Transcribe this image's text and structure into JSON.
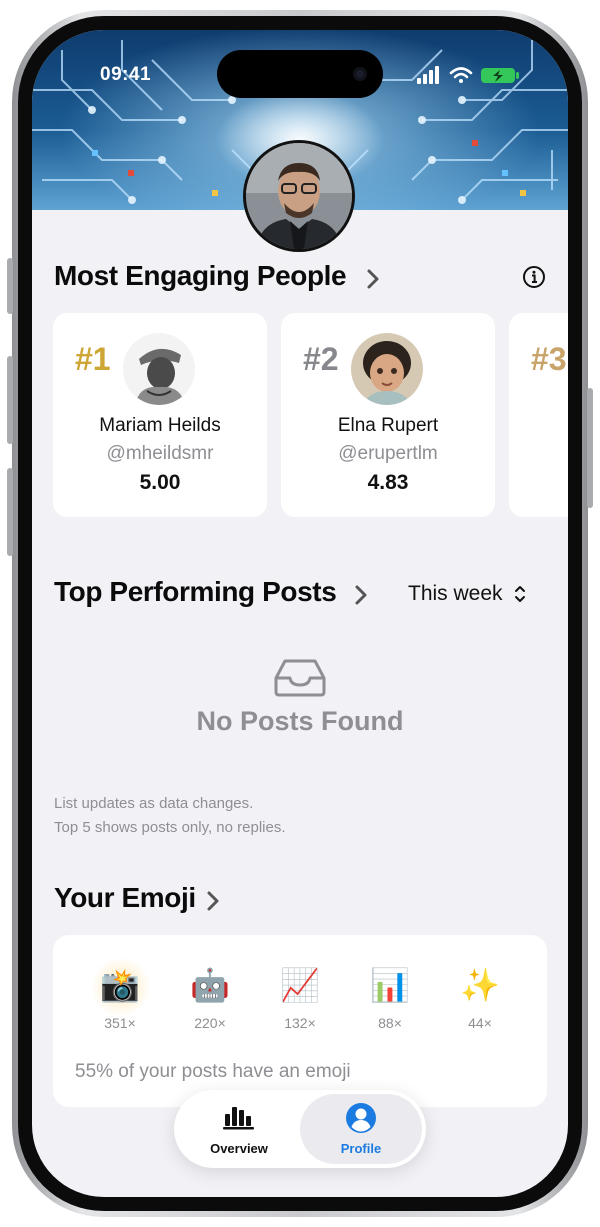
{
  "status_bar": {
    "time": "09:41"
  },
  "engaging": {
    "title": "Most Engaging People",
    "people": [
      {
        "rank": "#1",
        "name": "Mariam Heilds",
        "handle": "@mheildsmr",
        "score": "5.00"
      },
      {
        "rank": "#2",
        "name": "Elna Rupert",
        "handle": "@erupertlm",
        "score": "4.83"
      },
      {
        "rank": "#3",
        "name": "",
        "handle": "",
        "score": ""
      }
    ]
  },
  "posts": {
    "title": "Top Performing Posts",
    "filter": "This week",
    "empty_title": "No Posts Found",
    "footnote_1": "List updates as data changes.",
    "footnote_2": "Top 5 shows posts only, no replies."
  },
  "emoji": {
    "title": "Your Emoji",
    "items": [
      {
        "icon": "camera-with-flash-emoji",
        "glyph": "📸",
        "count": "351×"
      },
      {
        "icon": "robot-emoji",
        "glyph": "🤖",
        "count": "220×"
      },
      {
        "icon": "chart-increasing-emoji",
        "glyph": "📈",
        "count": "132×"
      },
      {
        "icon": "bar-chart-emoji",
        "glyph": "📊",
        "count": "88×"
      },
      {
        "icon": "sparkles-emoji",
        "glyph": "✨",
        "count": "44×"
      }
    ],
    "stat": "55% of your posts have an emoji"
  },
  "tabs": [
    {
      "label": "Overview",
      "icon": "bar-chart-icon",
      "active": false
    },
    {
      "label": "Profile",
      "icon": "person-circle-icon",
      "active": true
    }
  ],
  "colors": {
    "accent": "#1c7be0",
    "rank_gold": "#cea636",
    "rank_silver": "#87888d",
    "rank_bronze": "#c9a46a",
    "background": "#f2f2f6"
  }
}
